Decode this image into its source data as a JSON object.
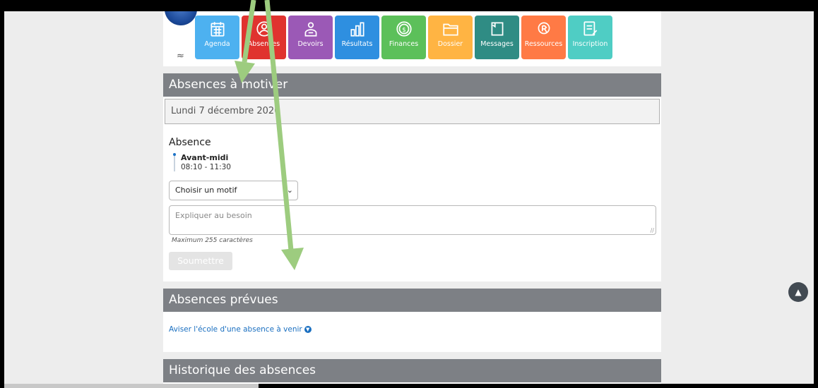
{
  "nav": {
    "tiles": [
      {
        "label": "Agenda",
        "color": "#4db1f0",
        "icon": "calendar-icon"
      },
      {
        "label": "Absences",
        "color": "#e0332f",
        "icon": "person-icon"
      },
      {
        "label": "Devoirs",
        "color": "#9b59b6",
        "icon": "student-icon"
      },
      {
        "label": "Résultats",
        "color": "#2e8fe0",
        "icon": "bar-chart-icon"
      },
      {
        "label": "Finances",
        "color": "#5cc05a",
        "icon": "dollar-coin-icon"
      },
      {
        "label": "Dossier",
        "color": "#ffb443",
        "icon": "folder-icon"
      },
      {
        "label": "Messages",
        "color": "#2f8c84",
        "icon": "message-icon"
      },
      {
        "label": "Ressources",
        "color": "#ff7a45",
        "icon": "resource-icon"
      },
      {
        "label": "Inscription",
        "color": "#4fcdc4",
        "icon": "signup-form-icon"
      }
    ]
  },
  "motiver": {
    "header": "Absences à motiver",
    "date": "Lundi 7 décembre 2020",
    "absence_title": "Absence",
    "period_label": "Avant-midi",
    "period_time": "08:10 - 11:30",
    "select_value": "Choisir un motif",
    "textarea_placeholder": "Expliquer au besoin",
    "max_note": "Maximum 255 caractères",
    "submit_label": "Soumettre"
  },
  "prevues": {
    "header": "Absences prévues",
    "link_label": "Aviser l'école d'une absence à venir"
  },
  "historique": {
    "header": "Historique des absences"
  },
  "colors": {
    "section_header": "#7d8085",
    "annotation_arrow": "#9dcc7f",
    "link": "#1a6fc0"
  }
}
